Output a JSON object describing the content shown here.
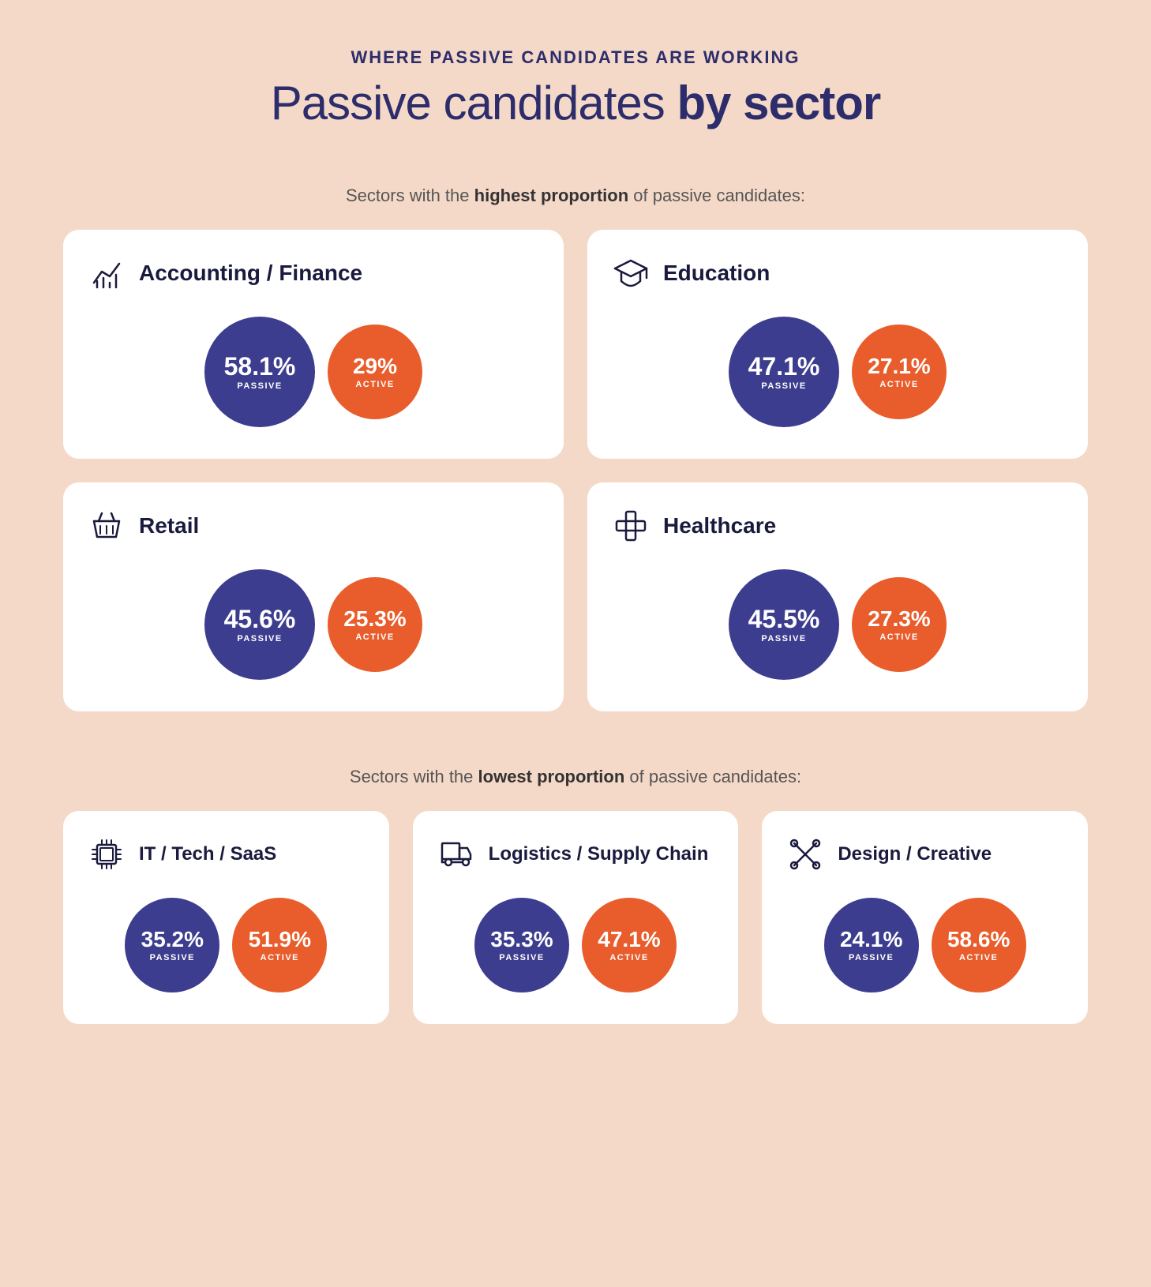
{
  "header": {
    "tag": "WHERE PASSIVE CANDIDATES ARE WORKING",
    "title_normal": "Passive candidates ",
    "title_bold": "by sector"
  },
  "highest_label": "Sectors with the ",
  "highest_bold": "highest proportion",
  "highest_suffix": " of passive candidates:",
  "lowest_label": "Sectors with the ",
  "lowest_bold": "lowest proportion",
  "lowest_suffix": " of passive candidates:",
  "highest_sectors": [
    {
      "id": "accounting-finance",
      "name": "Accounting / Finance",
      "icon": "chart-icon",
      "passive_pct": "58.1%",
      "passive_label": "PASSIVE",
      "active_pct": "29%",
      "active_label": "ACTIVE"
    },
    {
      "id": "education",
      "name": "Education",
      "icon": "graduation-icon",
      "passive_pct": "47.1%",
      "passive_label": "PASSIVE",
      "active_pct": "27.1%",
      "active_label": "ACTIVE"
    },
    {
      "id": "retail",
      "name": "Retail",
      "icon": "basket-icon",
      "passive_pct": "45.6%",
      "passive_label": "PASSIVE",
      "active_pct": "25.3%",
      "active_label": "ACTIVE"
    },
    {
      "id": "healthcare",
      "name": "Healthcare",
      "icon": "cross-icon",
      "passive_pct": "45.5%",
      "passive_label": "PASSIVE",
      "active_pct": "27.3%",
      "active_label": "ACTIVE"
    }
  ],
  "lowest_sectors": [
    {
      "id": "it-tech",
      "name": "IT / Tech / SaaS",
      "icon": "chip-icon",
      "passive_pct": "35.2%",
      "passive_label": "PASSIVE",
      "active_pct": "51.9%",
      "active_label": "ACTIVE"
    },
    {
      "id": "logistics",
      "name": "Logistics / Supply Chain",
      "icon": "logistics-icon",
      "passive_pct": "35.3%",
      "passive_label": "PASSIVE",
      "active_pct": "47.1%",
      "active_label": "ACTIVE"
    },
    {
      "id": "design-creative",
      "name": "Design / Creative",
      "icon": "design-icon",
      "passive_pct": "24.1%",
      "passive_label": "PASSIVE",
      "active_pct": "58.6%",
      "active_label": "ACTIVE"
    }
  ]
}
